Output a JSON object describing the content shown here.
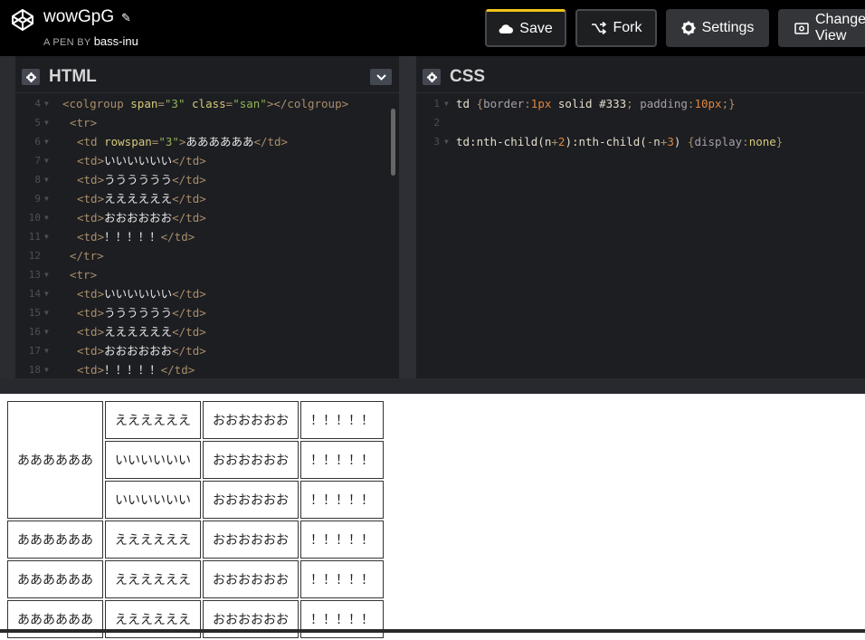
{
  "header": {
    "pen_title": "wowGpG",
    "byline_prefix": "A PEN BY",
    "author": "bass-inu",
    "buttons": {
      "save": "Save",
      "fork": "Fork",
      "settings": "Settings",
      "change_view": "Change View"
    }
  },
  "html_editor": {
    "title": "HTML",
    "lines": [
      {
        "n": "4",
        "fold": true,
        "indent": 0,
        "parts": [
          [
            "t",
            "<colgroup "
          ],
          [
            "a",
            "span"
          ],
          [
            "t",
            "="
          ],
          [
            "v",
            "\"3\""
          ],
          [
            "t",
            " "
          ],
          [
            "a",
            "class"
          ],
          [
            "t",
            "="
          ],
          [
            "v",
            "\"san\""
          ],
          [
            "t",
            "></colgroup>"
          ]
        ]
      },
      {
        "n": "5",
        "fold": true,
        "indent": 1,
        "parts": [
          [
            "t",
            "<tr>"
          ]
        ]
      },
      {
        "n": "6",
        "fold": true,
        "indent": 2,
        "parts": [
          [
            "t",
            "<td "
          ],
          [
            "a",
            "rowspan"
          ],
          [
            "t",
            "="
          ],
          [
            "v",
            "\"3\""
          ],
          [
            "t",
            ">"
          ],
          [
            "x",
            "ああああああ"
          ],
          [
            "t",
            "</td>"
          ]
        ]
      },
      {
        "n": "7",
        "fold": true,
        "indent": 2,
        "parts": [
          [
            "t",
            "<td>"
          ],
          [
            "x",
            "いいいいいい"
          ],
          [
            "t",
            "</td>"
          ]
        ]
      },
      {
        "n": "8",
        "fold": true,
        "indent": 2,
        "parts": [
          [
            "t",
            "<td>"
          ],
          [
            "x",
            "うううううう"
          ],
          [
            "t",
            "</td>"
          ]
        ]
      },
      {
        "n": "9",
        "fold": true,
        "indent": 2,
        "parts": [
          [
            "t",
            "<td>"
          ],
          [
            "x",
            "ええええええ"
          ],
          [
            "t",
            "</td>"
          ]
        ]
      },
      {
        "n": "10",
        "fold": true,
        "indent": 2,
        "parts": [
          [
            "t",
            "<td>"
          ],
          [
            "x",
            "おおおおおお"
          ],
          [
            "t",
            "</td>"
          ]
        ]
      },
      {
        "n": "11",
        "fold": true,
        "indent": 2,
        "parts": [
          [
            "t",
            "<td>"
          ],
          [
            "x",
            "！！！！！"
          ],
          [
            "t",
            "</td>"
          ]
        ]
      },
      {
        "n": "12",
        "fold": false,
        "indent": 1,
        "parts": [
          [
            "t",
            "</tr>"
          ]
        ]
      },
      {
        "n": "13",
        "fold": true,
        "indent": 1,
        "parts": [
          [
            "t",
            "<tr>"
          ]
        ]
      },
      {
        "n": "14",
        "fold": true,
        "indent": 2,
        "parts": [
          [
            "t",
            "<td>"
          ],
          [
            "x",
            "いいいいいい"
          ],
          [
            "t",
            "</td>"
          ]
        ]
      },
      {
        "n": "15",
        "fold": true,
        "indent": 2,
        "parts": [
          [
            "t",
            "<td>"
          ],
          [
            "x",
            "うううううう"
          ],
          [
            "t",
            "</td>"
          ]
        ]
      },
      {
        "n": "16",
        "fold": true,
        "indent": 2,
        "parts": [
          [
            "t",
            "<td>"
          ],
          [
            "x",
            "ええええええ"
          ],
          [
            "t",
            "</td>"
          ]
        ]
      },
      {
        "n": "17",
        "fold": true,
        "indent": 2,
        "parts": [
          [
            "t",
            "<td>"
          ],
          [
            "x",
            "おおおおおお"
          ],
          [
            "t",
            "</td>"
          ]
        ]
      },
      {
        "n": "18",
        "fold": true,
        "indent": 2,
        "parts": [
          [
            "t",
            "<td>"
          ],
          [
            "x",
            "！！！！！"
          ],
          [
            "t",
            "</td>"
          ]
        ]
      }
    ]
  },
  "css_editor": {
    "title": "CSS",
    "lines": [
      {
        "n": "1",
        "fold": true,
        "parts": [
          [
            "s",
            "td "
          ],
          [
            "t",
            "{"
          ],
          [
            "p",
            "border"
          ],
          [
            "t",
            ":"
          ],
          [
            "m",
            "1px"
          ],
          [
            "s",
            " solid "
          ],
          [
            "s",
            "#333"
          ],
          [
            "t",
            "; "
          ],
          [
            "p",
            "padding"
          ],
          [
            "t",
            ":"
          ],
          [
            "m",
            "10px"
          ],
          [
            "t",
            ";}"
          ]
        ]
      },
      {
        "n": "2",
        "fold": false,
        "parts": []
      },
      {
        "n": "3",
        "fold": true,
        "parts": [
          [
            "s",
            "td:nth-child("
          ],
          [
            "s",
            "n"
          ],
          [
            "t",
            "+"
          ],
          [
            "m",
            "2"
          ],
          [
            "s",
            "):nth-child("
          ],
          [
            "t",
            "-"
          ],
          [
            "s",
            "n"
          ],
          [
            "t",
            "+"
          ],
          [
            "m",
            "3"
          ],
          [
            "s",
            ") "
          ],
          [
            "t",
            "{"
          ],
          [
            "p",
            "display"
          ],
          [
            "t",
            ":"
          ],
          [
            "k",
            "none"
          ],
          [
            "t",
            "}"
          ]
        ]
      }
    ]
  },
  "result_table": [
    [
      {
        "text": "ああああああ",
        "rowspan": 3
      },
      {
        "text": "ええええええ"
      },
      {
        "text": "おおおおおお"
      },
      {
        "text": "！！！！！"
      }
    ],
    [
      {
        "text": "いいいいいい"
      },
      {
        "text": "おおおおおお"
      },
      {
        "text": "！！！！！"
      }
    ],
    [
      {
        "text": "いいいいいい"
      },
      {
        "text": "おおおおおお"
      },
      {
        "text": "！！！！！"
      }
    ],
    [
      {
        "text": "ああああああ"
      },
      {
        "text": "ええええええ"
      },
      {
        "text": "おおおおおお"
      },
      {
        "text": "！！！！！"
      }
    ],
    [
      {
        "text": "ああああああ"
      },
      {
        "text": "ええええええ"
      },
      {
        "text": "おおおおおお"
      },
      {
        "text": "！！！！！"
      }
    ],
    [
      {
        "text": "ああああああ"
      },
      {
        "text": "ええええええ"
      },
      {
        "text": "おおおおおお"
      },
      {
        "text": "！！！！！"
      }
    ]
  ],
  "colors": {
    "accent": "#f0c419",
    "editor_bg": "#1d1e22",
    "header_bg": "#000000"
  },
  "icons": {
    "logo": "codepen-logo-icon",
    "edit": "pencil-icon",
    "save": "cloud-icon",
    "fork": "fork-icon",
    "settings": "gear-icon",
    "change_view": "view-icon"
  }
}
